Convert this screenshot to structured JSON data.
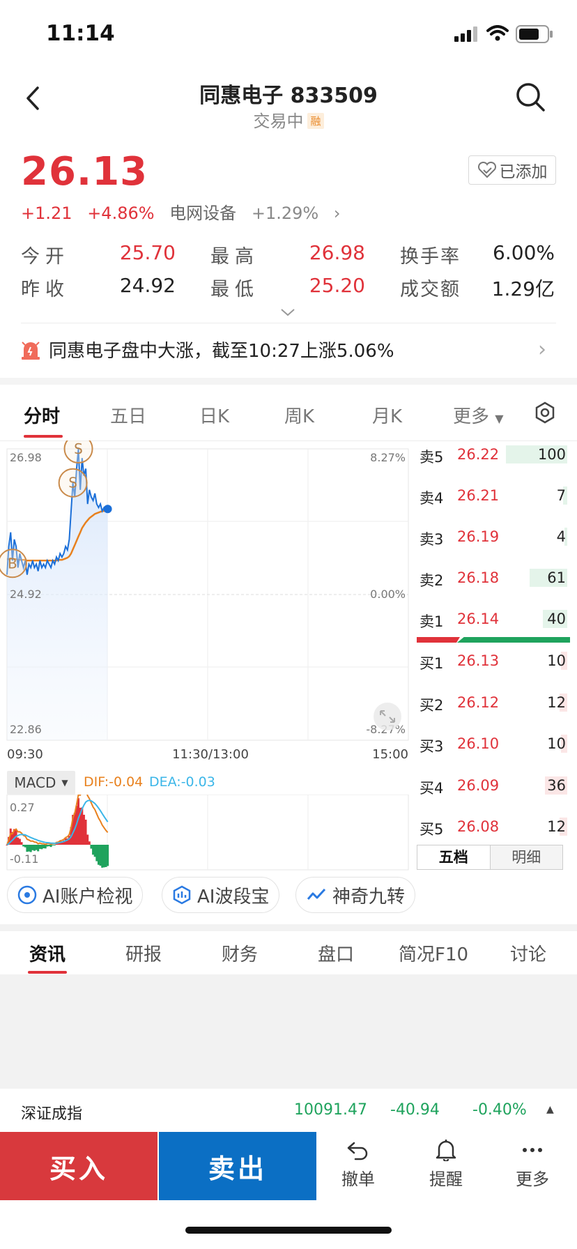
{
  "status": {
    "time": "11:14"
  },
  "header": {
    "title": "同惠电子  833509",
    "subtitle": "交易中",
    "badge": "融"
  },
  "quote": {
    "price": "26.13",
    "change": "+1.21",
    "change_pct": "+4.86%",
    "sector": "电网设备",
    "sector_pct": "+1.29%",
    "add_label": "已添加",
    "stats": [
      {
        "label": "今开",
        "value": "25.70"
      },
      {
        "label": "昨收",
        "value": "24.92"
      },
      {
        "label": "最高",
        "value": "26.98"
      },
      {
        "label": "最低",
        "value": "25.20"
      },
      {
        "label": "换手率",
        "value": "6.00%"
      },
      {
        "label": "成交额",
        "value": "1.29亿"
      }
    ]
  },
  "news_alert": "同惠电子盘中大涨，截至10:27上涨5.06%",
  "chart_tabs": [
    "分时",
    "五日",
    "日K",
    "周K",
    "月K",
    "更多"
  ],
  "chart_data": {
    "type": "line",
    "y_left_labels": [
      "26.98",
      "24.92",
      "22.86"
    ],
    "y_right_labels": [
      "8.27%",
      "0.00%",
      "-8.27%"
    ],
    "x_labels": [
      "09:30",
      "11:30/13:00",
      "15:00"
    ],
    "prev_close": 24.92,
    "ylim": [
      22.86,
      26.98
    ],
    "price_series": [
      25.2,
      25.6,
      25.8,
      25.4,
      25.7,
      25.6,
      25.3,
      25.5,
      25.4,
      25.3,
      25.4,
      25.2,
      25.35,
      25.3,
      25.4,
      25.3,
      25.35,
      25.25,
      25.4,
      25.3,
      25.35,
      25.3,
      25.4,
      25.35,
      25.3,
      25.4,
      25.35,
      25.45,
      25.4,
      25.5,
      25.45,
      25.5,
      25.6,
      25.55,
      25.7,
      26.1,
      26.5,
      26.3,
      26.7,
      26.98,
      26.4,
      26.85,
      26.6,
      26.7,
      26.2,
      26.4,
      26.3,
      26.25,
      26.35,
      26.2,
      26.15,
      26.2,
      26.1,
      26.15,
      26.12,
      26.13
    ],
    "avg_series": [
      25.42,
      25.42,
      25.43,
      25.42,
      25.42,
      25.42,
      25.41,
      25.41,
      25.41,
      25.41,
      25.41,
      25.4,
      25.4,
      25.4,
      25.4,
      25.4,
      25.4,
      25.4,
      25.4,
      25.4,
      25.4,
      25.4,
      25.4,
      25.4,
      25.4,
      25.4,
      25.4,
      25.4,
      25.41,
      25.41,
      25.41,
      25.42,
      25.43,
      25.44,
      25.46,
      25.5,
      25.56,
      25.62,
      25.68,
      25.74,
      25.8,
      25.86,
      25.9,
      25.94,
      25.97,
      26.0,
      26.02,
      26.04,
      26.06,
      26.07,
      26.08,
      26.09,
      26.1,
      26.1,
      26.1,
      26.1
    ],
    "markers": [
      "B",
      "S",
      "S"
    ],
    "macd": {
      "indicator": "MACD",
      "dif_label": "DIF:",
      "dif": "-0.04",
      "dea_label": "DEA:",
      "dea": "-0.03",
      "y_top": "0.27",
      "y_bottom": "-0.11"
    }
  },
  "order_book": {
    "sells": [
      {
        "label": "卖5",
        "price": "26.22",
        "vol": "100"
      },
      {
        "label": "卖4",
        "price": "26.21",
        "vol": "7"
      },
      {
        "label": "卖3",
        "price": "26.19",
        "vol": "4"
      },
      {
        "label": "卖2",
        "price": "26.18",
        "vol": "61"
      },
      {
        "label": "卖1",
        "price": "26.14",
        "vol": "40"
      }
    ],
    "buys": [
      {
        "label": "买1",
        "price": "26.13",
        "vol": "10"
      },
      {
        "label": "买2",
        "price": "26.12",
        "vol": "12"
      },
      {
        "label": "买3",
        "price": "26.10",
        "vol": "10"
      },
      {
        "label": "买4",
        "price": "26.09",
        "vol": "36"
      },
      {
        "label": "买5",
        "price": "26.08",
        "vol": "12"
      }
    ],
    "tab_five": "五档",
    "tab_detail": "明细"
  },
  "tools": [
    "AI账户检视",
    "AI波段宝",
    "神奇九转"
  ],
  "bottom_tabs": [
    "资讯",
    "研报",
    "财务",
    "盘口",
    "简况F10",
    "讨论"
  ],
  "index_bar": {
    "name": "深证成指",
    "value": "10091.47",
    "change": "-40.94",
    "pct": "-0.40%"
  },
  "actions": {
    "buy": "买入",
    "sell": "卖出",
    "cancel": "撤单",
    "alert": "提醒",
    "more": "更多"
  }
}
